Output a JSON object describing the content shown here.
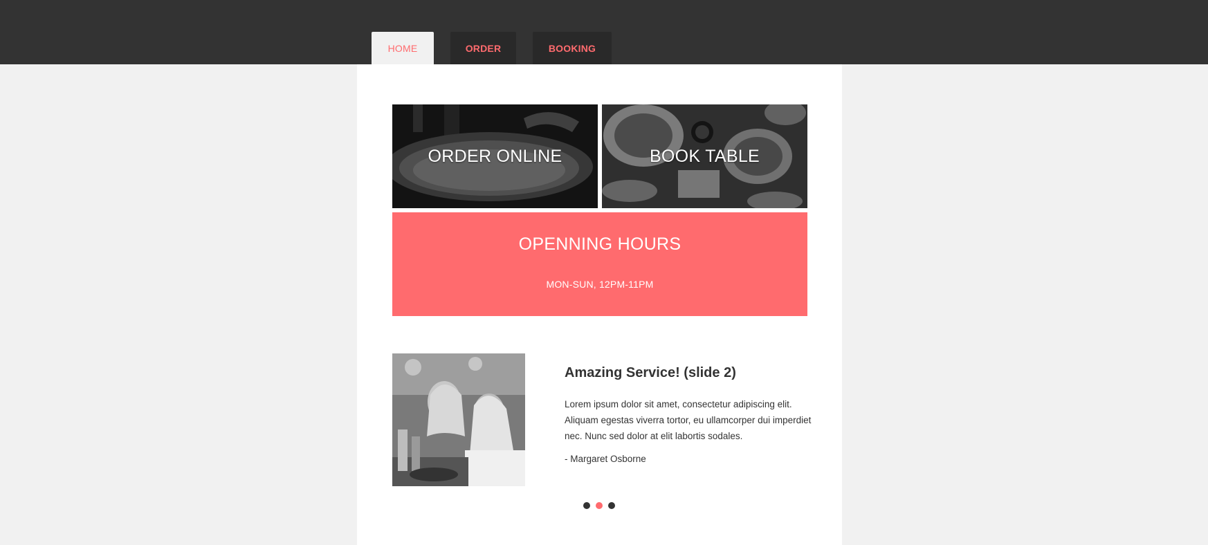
{
  "nav": {
    "tabs": [
      {
        "label": "HOME",
        "active": true
      },
      {
        "label": "ORDER",
        "active": false
      },
      {
        "label": "BOOKING",
        "active": false
      }
    ]
  },
  "tiles": {
    "order_online": "ORDER ONLINE",
    "book_table": "BOOK TABLE"
  },
  "hours": {
    "title": "OPENNING HOURS",
    "time": "MON-SUN, 12PM-11PM"
  },
  "testimonial": {
    "title": "Amazing Service! (slide 2)",
    "text": "Lorem ipsum dolor sit amet, consectetur adipiscing elit. Aliquam egestas viverra tortor, eu ullamcorper dui imperdiet nec. Nunc sed dolor at elit labortis sodales.",
    "author": "- Margaret Osborne",
    "slide_count": 3,
    "active_slide": 2
  },
  "colors": {
    "accent": "#ff6b6e",
    "topbar": "#333333",
    "page_bg": "#f1f1f1",
    "content_bg": "#ffffff"
  }
}
